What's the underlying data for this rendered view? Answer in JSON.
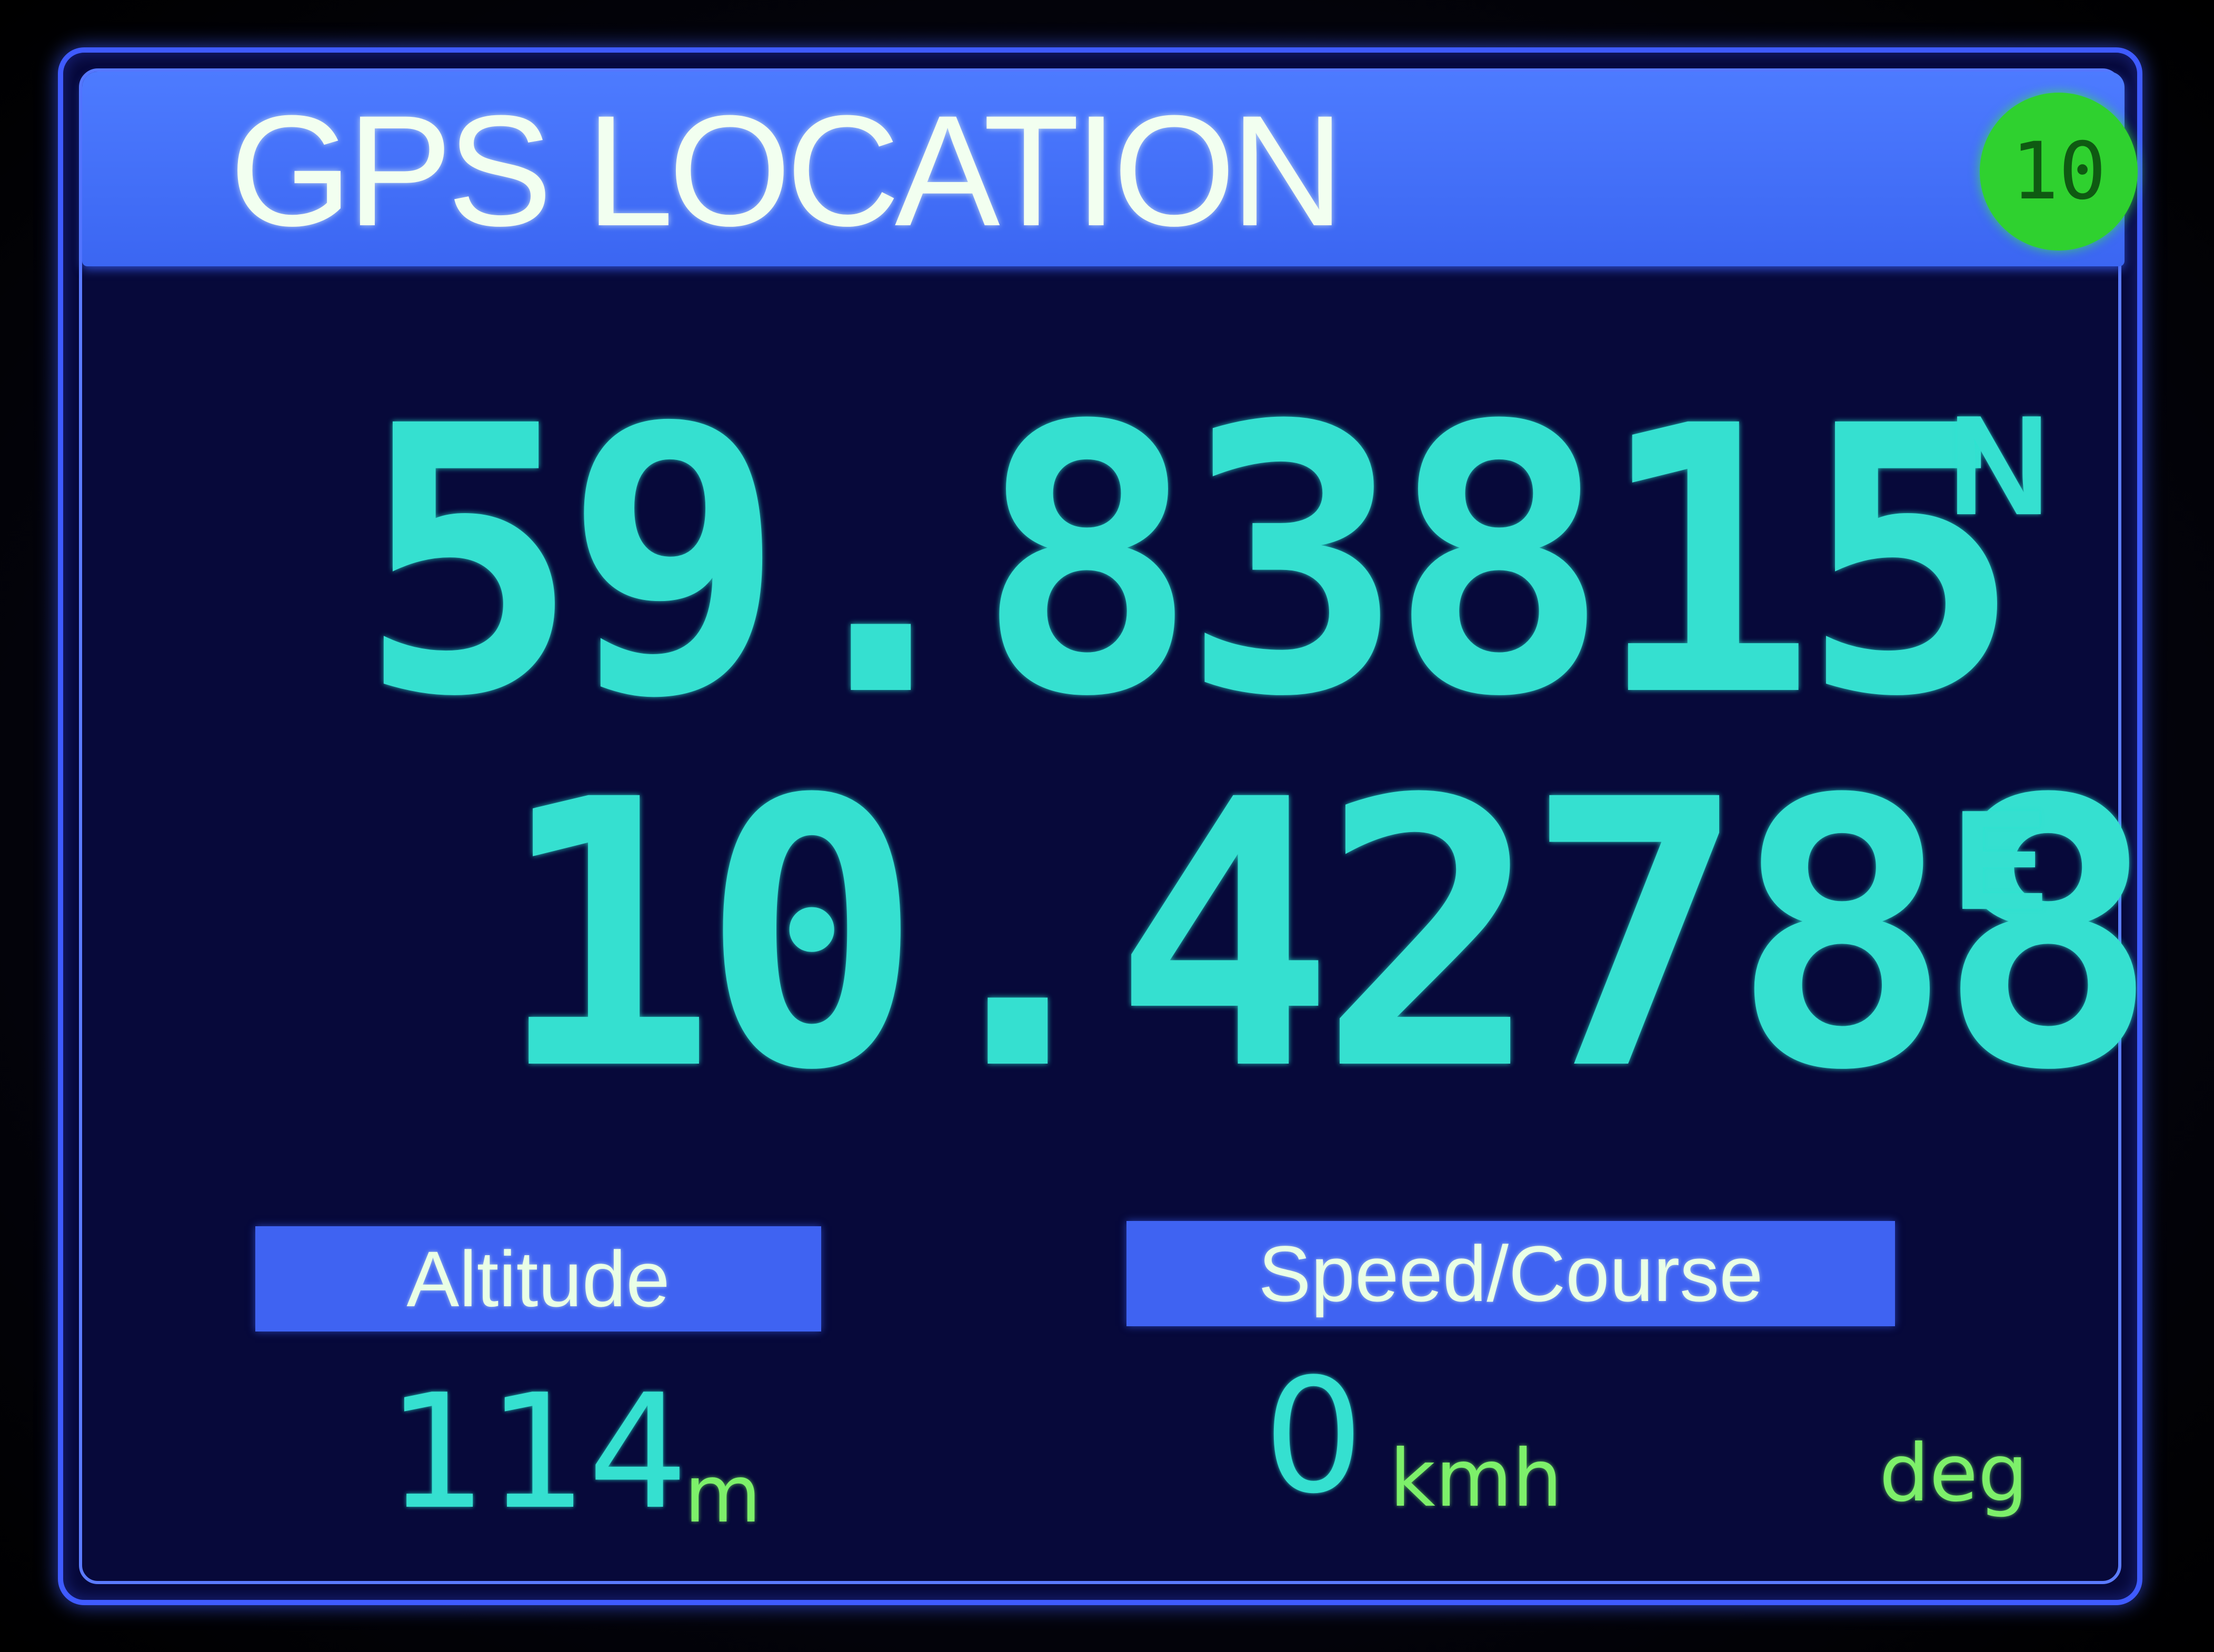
{
  "header": {
    "title": "GPS LOCATION",
    "satellite_count": "10"
  },
  "coordinates": {
    "latitude": "59.83815",
    "latitude_hemisphere": "N",
    "longitude": "10.42788",
    "longitude_hemisphere": "E"
  },
  "altitude": {
    "label": "Altitude",
    "value": "114",
    "unit": "m"
  },
  "speed_course": {
    "label": "Speed/Course",
    "speed_value": "0",
    "speed_unit": "kmh",
    "course_value": "",
    "course_unit": "deg"
  },
  "colors": {
    "background": "#07093a",
    "accent_blue": "#3f63f2",
    "digit_cyan": "#35e0d0",
    "unit_green": "#7df06a",
    "badge_green": "#2fd12f"
  }
}
